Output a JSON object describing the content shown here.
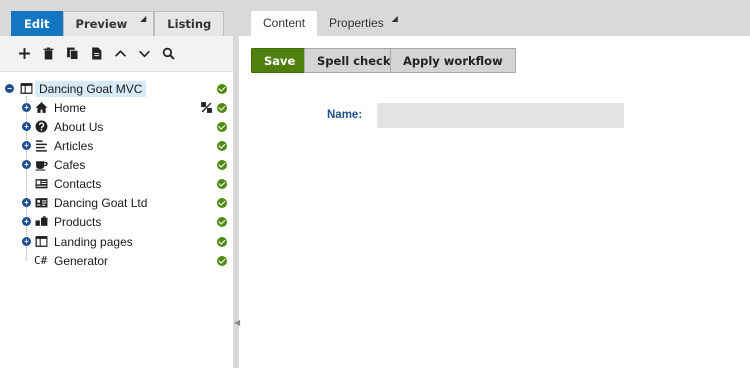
{
  "modes": {
    "edit": "Edit",
    "preview": "Preview",
    "listing": "Listing"
  },
  "tabs": {
    "content": "Content",
    "properties": "Properties"
  },
  "toolbar_icons": [
    "plus-icon",
    "delete-icon",
    "copy-icon",
    "document-icon",
    "chevron-up-icon",
    "chevron-down-icon",
    "search-icon"
  ],
  "tree": {
    "root": "Dancing Goat MVC",
    "items": [
      {
        "label": "Home",
        "icon": "home-icon"
      },
      {
        "label": "About Us",
        "icon": "question-icon"
      },
      {
        "label": "Articles",
        "icon": "list-icon"
      },
      {
        "label": "Cafes",
        "icon": "cup-icon"
      },
      {
        "label": "Contacts",
        "icon": "contact-card-icon"
      },
      {
        "label": "Dancing Goat Ltd",
        "icon": "id-card-icon"
      },
      {
        "label": "Products",
        "icon": "products-icon"
      },
      {
        "label": "Landing pages",
        "icon": "layout-icon"
      },
      {
        "label": "Generator",
        "icon": "csharp-icon",
        "glyph": "C#"
      }
    ]
  },
  "buttons": {
    "save": "Save",
    "spell_check": "Spell check",
    "apply_workflow": "Apply workflow"
  },
  "form": {
    "name_label": "Name:",
    "name_value": ""
  },
  "colors": {
    "active_mode": "#1476c0",
    "save": "#4f7f0d",
    "status_ok": "#4f8a10",
    "label": "#1f4e8c"
  }
}
